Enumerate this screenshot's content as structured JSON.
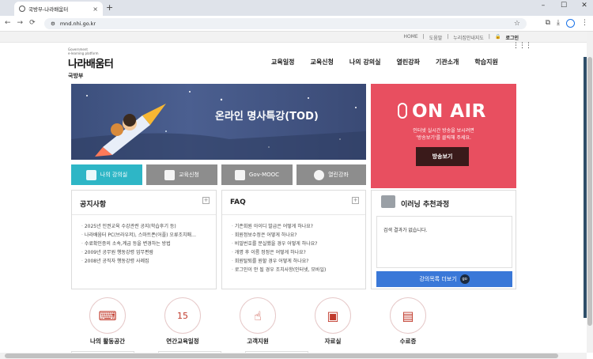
{
  "browser": {
    "tab_title": "국방부-나라배움터",
    "tab_close": "×",
    "new_tab": "+",
    "url": "mnd.nhi.go.kr",
    "window_controls": [
      "–",
      "☐",
      "✕"
    ]
  },
  "util": {
    "links": [
      "HOME",
      "도움말",
      "누리집안내지도"
    ],
    "login": "로그인"
  },
  "logo": {
    "subtitle1": "Government",
    "subtitle2": "e-learning platform",
    "name": "나라배움터",
    "org": "국방부"
  },
  "gnb": [
    "교육일정",
    "교육신청",
    "나의 강의실",
    "열린강좌",
    "기관소개",
    "학습지원"
  ],
  "hero": {
    "title": "온라인 명사특강(TOD)"
  },
  "onair": {
    "title": "ON AIR",
    "desc1": "인터넷 실시간 방송을 보시려면",
    "desc2": "'방송보기'를 클릭해 주세요.",
    "button": "방송보기"
  },
  "quick": [
    {
      "label": "나의 강의실",
      "color": "#2eb6c6"
    },
    {
      "label": "교육신청",
      "color": "#8d8d8d"
    },
    {
      "label": "Gov-MOOC",
      "color": "#8d8d8d"
    },
    {
      "label": "열린강좌",
      "color": "#8d8d8d"
    }
  ],
  "notice": {
    "title": "공지사항",
    "items": [
      "2025년 인권교육 수강관련 공지(학습후기 등)",
      "나라배움터 PC(브라우저), 스마트폰(어플) 오류조치매…",
      "수료확인증의 소속,계급 등을 변경하는 방법",
      "2009년 공무원 행동강령 업무편람",
      "2008년 공직자 행동강령 사례집"
    ]
  },
  "faq": {
    "title": "FAQ",
    "items": [
      "기존회원 아이디 발급은 어떻게 하나요?",
      "회원정보수정은 어떻게 하나요?",
      "비밀번호를 분실했을 경우 어떻게 하나요?",
      "개명 후 이름 정정은 어떻게 하나요?",
      "회원탈퇴를 원할 경우 어떻게 하나요?",
      "로그인이 안 될 경우 조치사항(인터넷, 모바일)"
    ]
  },
  "recommend": {
    "title": "이러닝 추천과정",
    "empty": "검색 결과가 없습니다.",
    "more": "강의목록 더보기",
    "go": "go"
  },
  "icons": [
    {
      "label": "나의 활동공간",
      "glyph": "⌨"
    },
    {
      "label": "연간교육일정",
      "glyph": "15"
    },
    {
      "label": "고객지원",
      "glyph": "☝"
    },
    {
      "label": "자료실",
      "glyph": "▣"
    },
    {
      "label": "수료증",
      "glyph": "▤"
    }
  ],
  "colors": {
    "onair": "#e84f60",
    "accent_blue": "#3a78d8",
    "teal": "#2eb6c6"
  }
}
